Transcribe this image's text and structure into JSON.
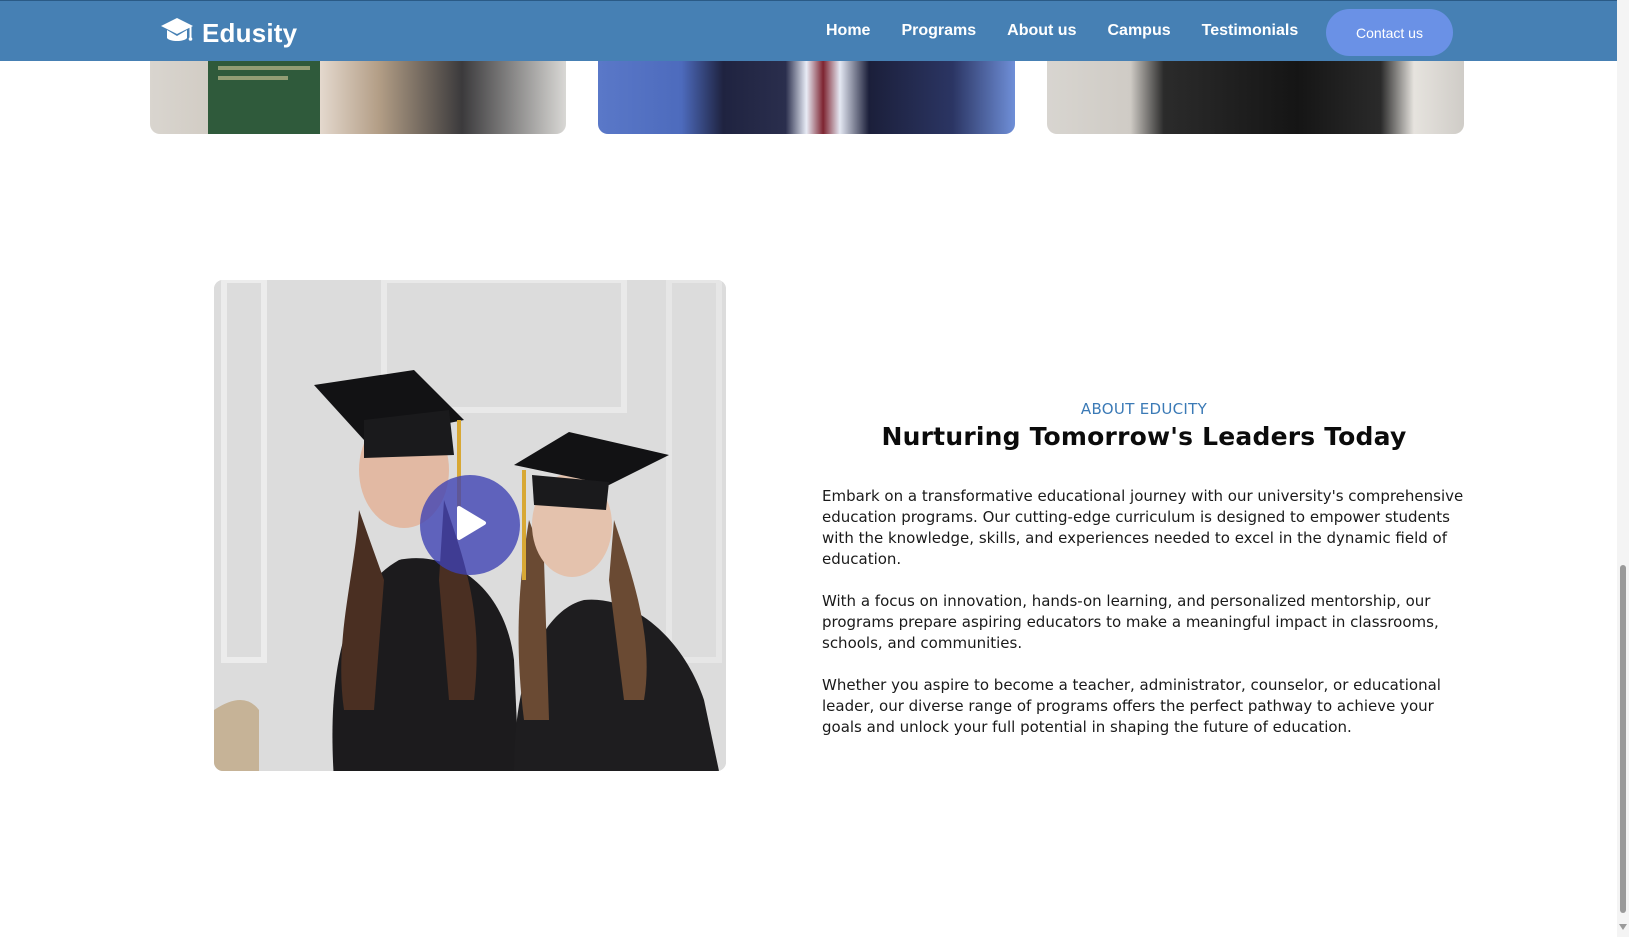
{
  "brand": {
    "name": "Edusity",
    "icon": "graduation-cap-icon"
  },
  "nav": {
    "links": [
      "Home",
      "Programs",
      "About us",
      "Campus",
      "Testimonials"
    ],
    "contact_label": "Contact us"
  },
  "about": {
    "eyebrow": "ABOUT EDUCITY",
    "headline": "Nurturing Tomorrow's Leaders Today",
    "paragraphs": [
      "Embark on a transformative educational journey with our university's comprehensive education programs. Our cutting-edge curriculum is designed to empower students with the knowledge, skills, and experiences needed to excel in the dynamic field of education.",
      "With a focus on innovation, hands-on learning, and personalized mentorship, our programs prepare aspiring educators to make a meaningful impact in classrooms, schools, and communities.",
      "Whether you aspire to become a teacher, administrator, counselor, or educational leader, our diverse range of programs offers the perfect pathway to achieve your goals and unlock your full potential in shaping the future of education."
    ],
    "video_icon": "play-icon"
  },
  "colors": {
    "navbar": "#4680b4",
    "contact_button": "#6a91e6",
    "accent_text": "#3b7ab6",
    "play_button": "#3c40b4"
  }
}
